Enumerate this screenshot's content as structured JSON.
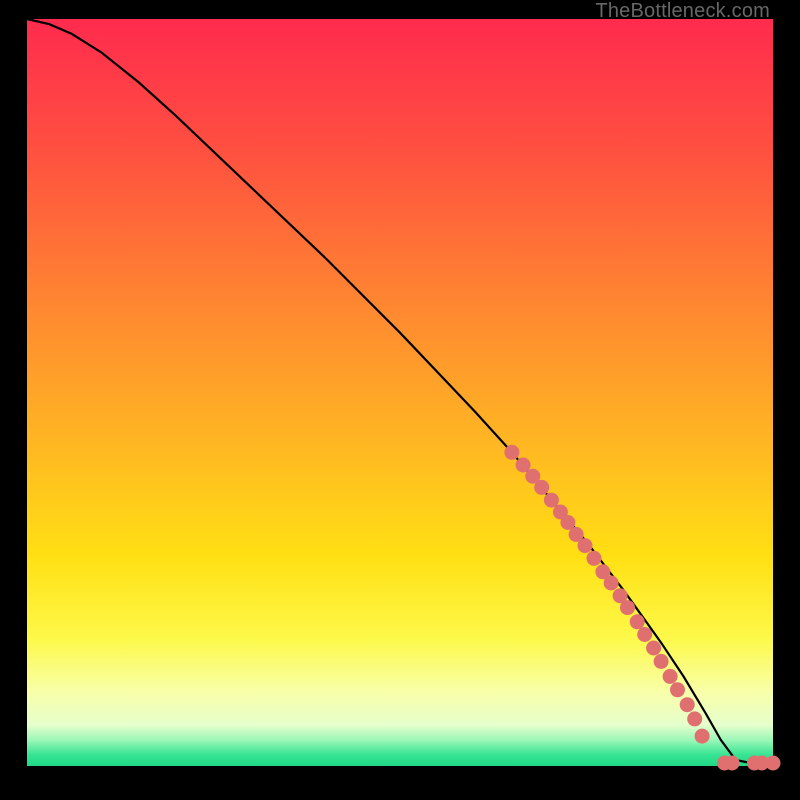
{
  "watermark": "TheBottleneck.com",
  "colors": {
    "background": "#000000",
    "curve": "#000000",
    "marker": "#e07070",
    "gradient_stops": [
      {
        "offset": 0.0,
        "color": "#ff2b4e"
      },
      {
        "offset": 0.18,
        "color": "#ff5140"
      },
      {
        "offset": 0.35,
        "color": "#ff7e33"
      },
      {
        "offset": 0.55,
        "color": "#ffb224"
      },
      {
        "offset": 0.72,
        "color": "#ffe013"
      },
      {
        "offset": 0.83,
        "color": "#fdf94a"
      },
      {
        "offset": 0.9,
        "color": "#f8ffa8"
      },
      {
        "offset": 0.945,
        "color": "#e6ffcc"
      },
      {
        "offset": 0.965,
        "color": "#9cf7b8"
      },
      {
        "offset": 0.985,
        "color": "#37e493"
      },
      {
        "offset": 1.0,
        "color": "#1fd885"
      }
    ]
  },
  "chart_data": {
    "type": "line",
    "title": "",
    "xlabel": "",
    "ylabel": "",
    "xlim": [
      0,
      100
    ],
    "ylim": [
      0,
      100
    ],
    "curve": {
      "x": [
        0,
        3,
        6,
        10,
        15,
        20,
        30,
        40,
        50,
        60,
        65,
        70,
        75,
        80,
        85,
        88,
        91,
        93,
        95,
        97,
        100
      ],
      "y": [
        100,
        99.3,
        98.0,
        95.5,
        91.5,
        87.0,
        77.5,
        68.0,
        58.0,
        47.5,
        42.0,
        36.0,
        30.0,
        23.5,
        16.5,
        12.0,
        7.0,
        3.5,
        0.8,
        0.4,
        0.4
      ]
    },
    "markers": {
      "x": [
        65.0,
        66.5,
        67.8,
        69.0,
        70.3,
        71.5,
        72.5,
        73.6,
        74.8,
        76.0,
        77.2,
        78.3,
        79.5,
        80.5,
        81.8,
        82.8,
        84.0,
        85.0,
        86.2,
        87.2,
        88.5,
        89.5,
        90.5,
        93.5,
        94.5,
        97.5,
        98.5,
        100.0
      ],
      "y": [
        42.0,
        40.3,
        38.8,
        37.3,
        35.6,
        34.0,
        32.6,
        31.0,
        29.5,
        27.8,
        26.0,
        24.5,
        22.8,
        21.2,
        19.3,
        17.6,
        15.8,
        14.0,
        12.0,
        10.2,
        8.2,
        6.3,
        4.0,
        0.4,
        0.4,
        0.4,
        0.4,
        0.4
      ]
    }
  }
}
